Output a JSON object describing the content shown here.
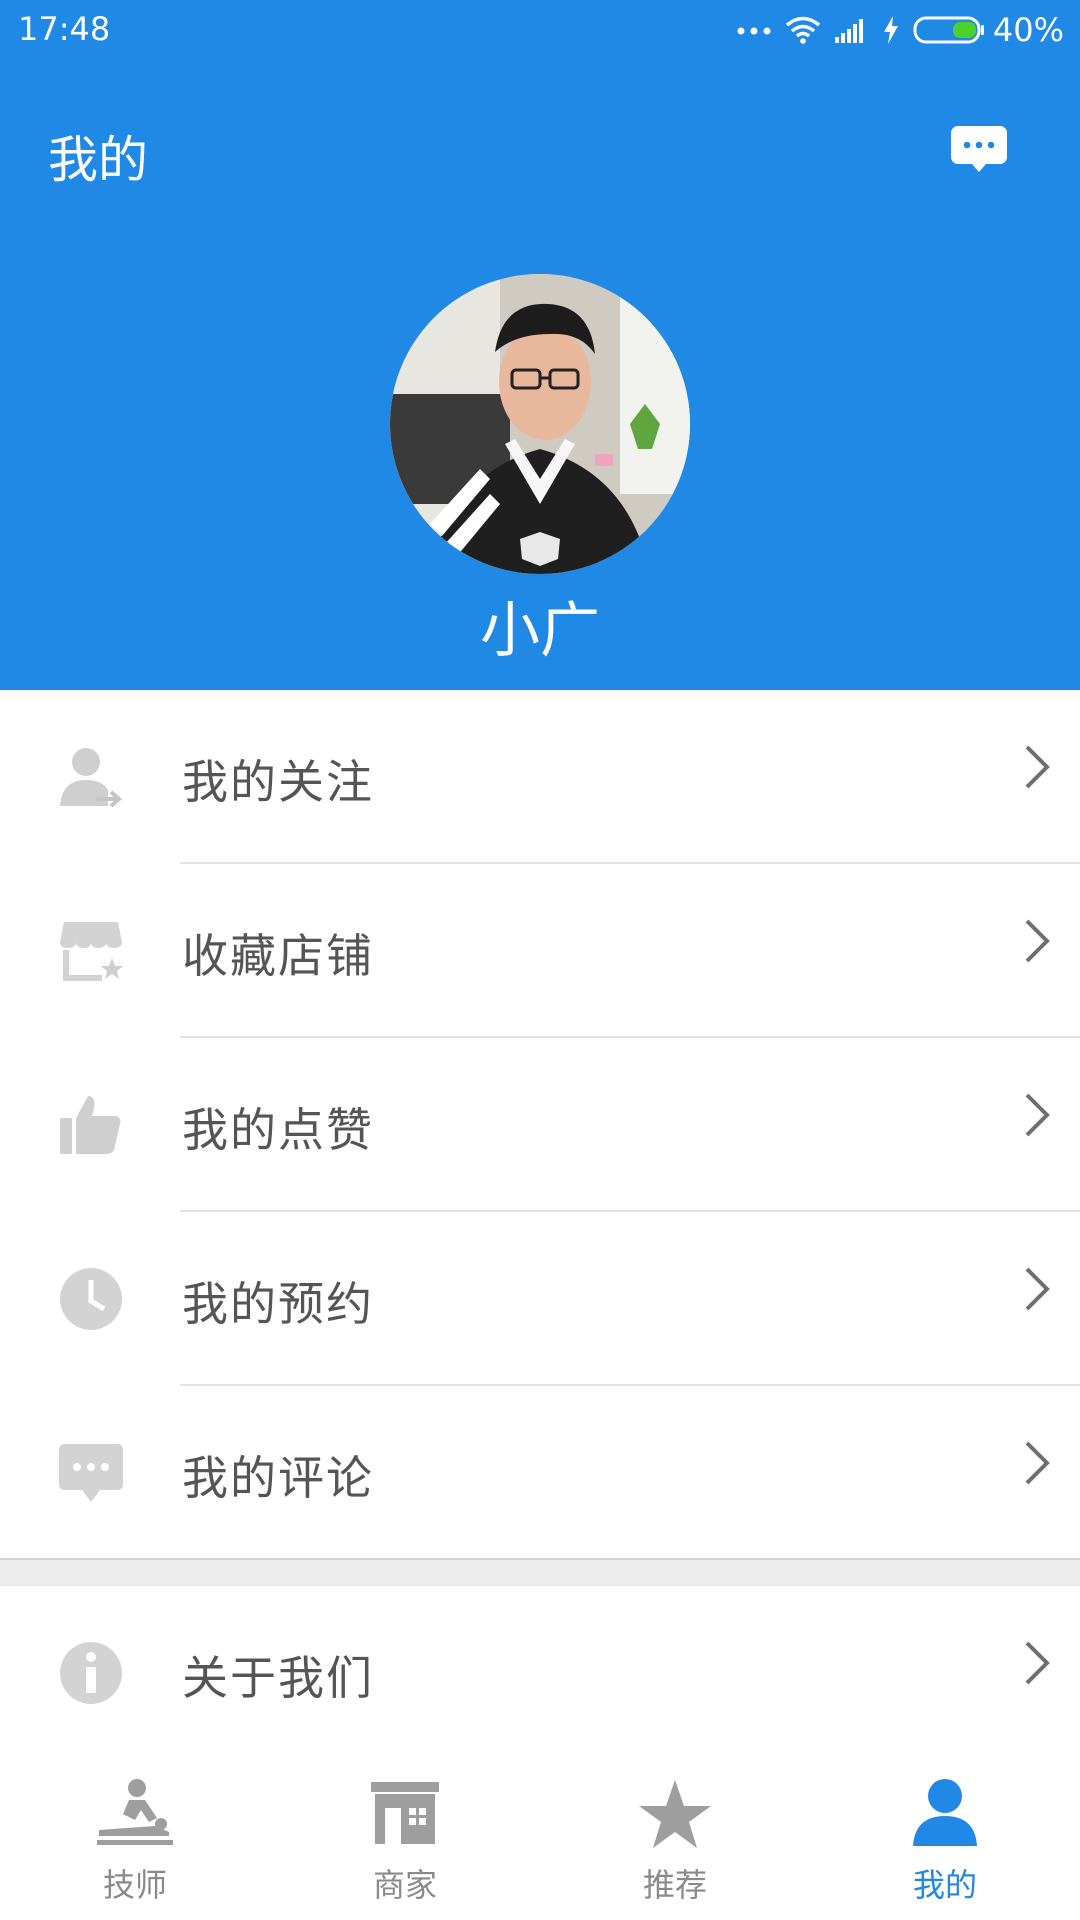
{
  "status_bar": {
    "time": "17:48",
    "battery": "40%",
    "icons": [
      "more-dots-icon",
      "wifi-icon",
      "signal-icon",
      "charging-icon",
      "battery-icon"
    ]
  },
  "header": {
    "title": "我的",
    "message_icon": "message-icon",
    "background_color": "#2088e5"
  },
  "profile": {
    "username": "小广"
  },
  "menu": {
    "items": [
      {
        "label": "我的关注",
        "icon": "follow-user-icon"
      },
      {
        "label": "收藏店铺",
        "icon": "favorite-store-icon"
      },
      {
        "label": "我的点赞",
        "icon": "thumbs-up-icon"
      },
      {
        "label": "我的预约",
        "icon": "clock-icon"
      },
      {
        "label": "我的评论",
        "icon": "comment-icon"
      }
    ],
    "about": {
      "label": "关于我们",
      "icon": "info-icon"
    }
  },
  "tabbar": {
    "active_color": "#2088e5",
    "inactive_color": "#8a8a8a",
    "tabs": [
      {
        "label": "技师",
        "icon": "massage-icon",
        "active": false
      },
      {
        "label": "商家",
        "icon": "shop-icon",
        "active": false
      },
      {
        "label": "推荐",
        "icon": "star-icon",
        "active": false
      },
      {
        "label": "我的",
        "icon": "user-icon",
        "active": true
      }
    ]
  }
}
